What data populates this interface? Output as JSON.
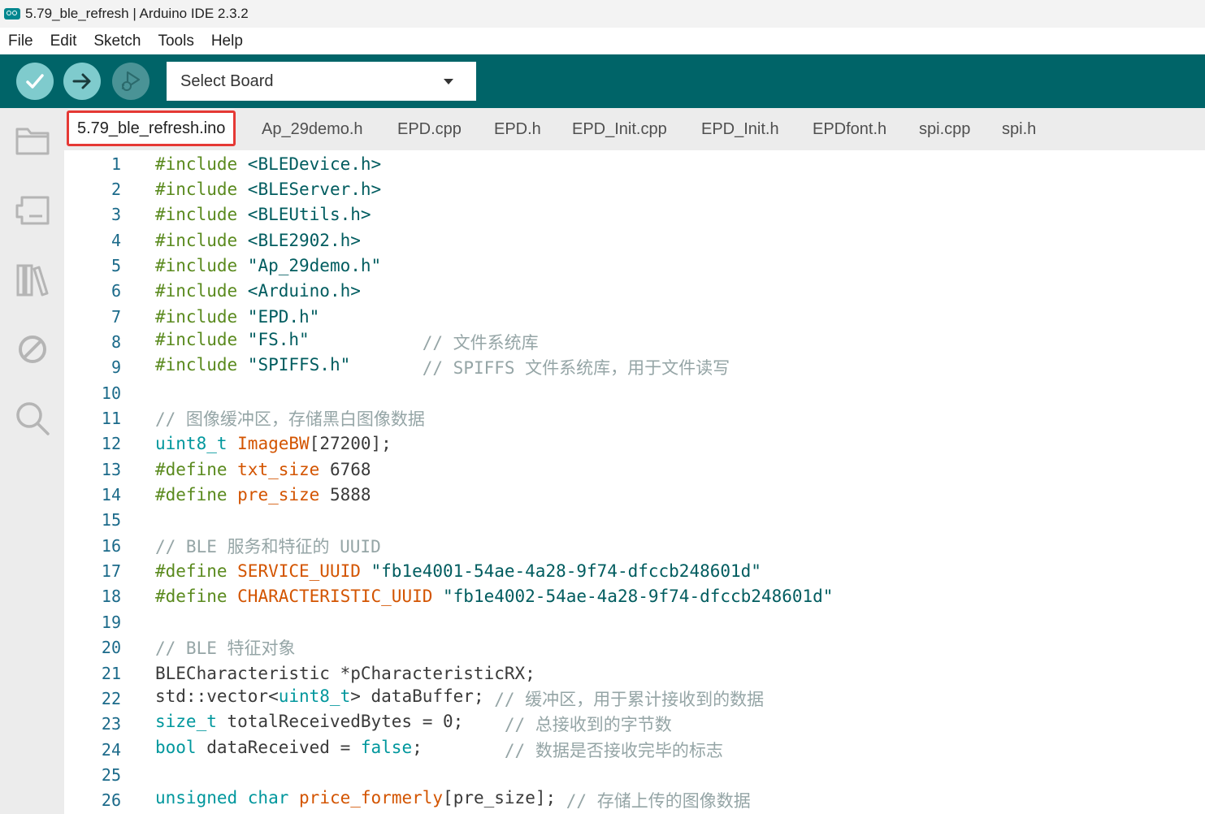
{
  "window": {
    "title": "5.79_ble_refresh | Arduino IDE 2.3.2"
  },
  "menu": [
    "File",
    "Edit",
    "Sketch",
    "Tools",
    "Help"
  ],
  "toolbar": {
    "verify_icon": "check-icon",
    "upload_icon": "arrow-right-icon",
    "debug_icon": "debug-icon",
    "board_select": "Select Board"
  },
  "sidebar": {
    "items": [
      "folder-icon",
      "board-icon",
      "library-icon",
      "debug-block-icon",
      "search-icon"
    ]
  },
  "tabs": [
    {
      "label": "5.79_ble_refresh.ino",
      "active": true
    },
    {
      "label": "Ap_29demo.h"
    },
    {
      "label": "EPD.cpp"
    },
    {
      "label": "EPD.h"
    },
    {
      "label": "EPD_Init.cpp"
    },
    {
      "label": "EPD_Init.h"
    },
    {
      "label": "EPDfont.h"
    },
    {
      "label": "spi.cpp"
    },
    {
      "label": "spi.h"
    }
  ],
  "colors": {
    "toolbar_bg": "#006468",
    "button_bg": "#7fcbcd",
    "active_tab_outline": "#e53935"
  },
  "code_lines": [
    {
      "n": "1",
      "tokens": [
        [
          "pp",
          "#include "
        ],
        [
          "str",
          "<BLEDevice.h>"
        ]
      ]
    },
    {
      "n": "2",
      "tokens": [
        [
          "pp",
          "#include "
        ],
        [
          "str",
          "<BLEServer.h>"
        ]
      ]
    },
    {
      "n": "3",
      "tokens": [
        [
          "pp",
          "#include "
        ],
        [
          "str",
          "<BLEUtils.h>"
        ]
      ]
    },
    {
      "n": "4",
      "tokens": [
        [
          "pp",
          "#include "
        ],
        [
          "str",
          "<BLE2902.h>"
        ]
      ]
    },
    {
      "n": "5",
      "tokens": [
        [
          "pp",
          "#include "
        ],
        [
          "str",
          "\"Ap_29demo.h\""
        ]
      ]
    },
    {
      "n": "6",
      "tokens": [
        [
          "pp",
          "#include "
        ],
        [
          "str",
          "<Arduino.h>"
        ]
      ]
    },
    {
      "n": "7",
      "tokens": [
        [
          "pp",
          "#include "
        ],
        [
          "str",
          "\"EPD.h\""
        ]
      ]
    },
    {
      "n": "8",
      "tokens": [
        [
          "pp",
          "#include "
        ],
        [
          "str",
          "\"FS.h\""
        ],
        [
          "plain",
          "           "
        ],
        [
          "com",
          "// 文件系统库"
        ]
      ]
    },
    {
      "n": "9",
      "tokens": [
        [
          "pp",
          "#include "
        ],
        [
          "str",
          "\"SPIFFS.h\""
        ],
        [
          "plain",
          "       "
        ],
        [
          "com",
          "// SPIFFS 文件系统库，用于文件读写"
        ]
      ]
    },
    {
      "n": "10",
      "tokens": []
    },
    {
      "n": "11",
      "tokens": [
        [
          "com",
          "// 图像缓冲区，存储黑白图像数据"
        ]
      ]
    },
    {
      "n": "12",
      "tokens": [
        [
          "type",
          "uint8_t "
        ],
        [
          "def",
          "ImageBW"
        ],
        [
          "plain",
          "[27200];"
        ]
      ]
    },
    {
      "n": "13",
      "tokens": [
        [
          "pp",
          "#define "
        ],
        [
          "def",
          "txt_size"
        ],
        [
          "plain",
          " 6768"
        ]
      ]
    },
    {
      "n": "14",
      "tokens": [
        [
          "pp",
          "#define "
        ],
        [
          "def",
          "pre_size"
        ],
        [
          "plain",
          " 5888"
        ]
      ]
    },
    {
      "n": "15",
      "tokens": []
    },
    {
      "n": "16",
      "tokens": [
        [
          "com",
          "// BLE 服务和特征的 UUID"
        ]
      ]
    },
    {
      "n": "17",
      "tokens": [
        [
          "pp",
          "#define "
        ],
        [
          "def",
          "SERVICE_UUID"
        ],
        [
          "str",
          " \"fb1e4001-54ae-4a28-9f74-dfccb248601d\""
        ]
      ]
    },
    {
      "n": "18",
      "tokens": [
        [
          "pp",
          "#define "
        ],
        [
          "def",
          "CHARACTERISTIC_UUID"
        ],
        [
          "str",
          " \"fb1e4002-54ae-4a28-9f74-dfccb248601d\""
        ]
      ]
    },
    {
      "n": "19",
      "tokens": []
    },
    {
      "n": "20",
      "tokens": [
        [
          "com",
          "// BLE 特征对象"
        ]
      ]
    },
    {
      "n": "21",
      "tokens": [
        [
          "plain",
          "BLECharacteristic *pCharacteristicRX;"
        ]
      ]
    },
    {
      "n": "22",
      "tokens": [
        [
          "plain",
          "std::vector<"
        ],
        [
          "type",
          "uint8_t"
        ],
        [
          "plain",
          "> dataBuffer; "
        ],
        [
          "com",
          "// 缓冲区，用于累计接收到的数据"
        ]
      ]
    },
    {
      "n": "23",
      "tokens": [
        [
          "type",
          "size_t"
        ],
        [
          "plain",
          " totalReceivedBytes = 0;    "
        ],
        [
          "com",
          "// 总接收到的字节数"
        ]
      ]
    },
    {
      "n": "24",
      "tokens": [
        [
          "type",
          "bool"
        ],
        [
          "plain",
          " dataReceived = "
        ],
        [
          "type",
          "false"
        ],
        [
          "plain",
          ";        "
        ],
        [
          "com",
          "// 数据是否接收完毕的标志"
        ]
      ]
    },
    {
      "n": "25",
      "tokens": []
    },
    {
      "n": "26",
      "tokens": [
        [
          "type",
          "unsigned char"
        ],
        [
          "plain",
          " "
        ],
        [
          "def",
          "price_formerly"
        ],
        [
          "plain",
          "[pre_size]; "
        ],
        [
          "com",
          "// 存储上传的图像数据"
        ]
      ]
    }
  ]
}
